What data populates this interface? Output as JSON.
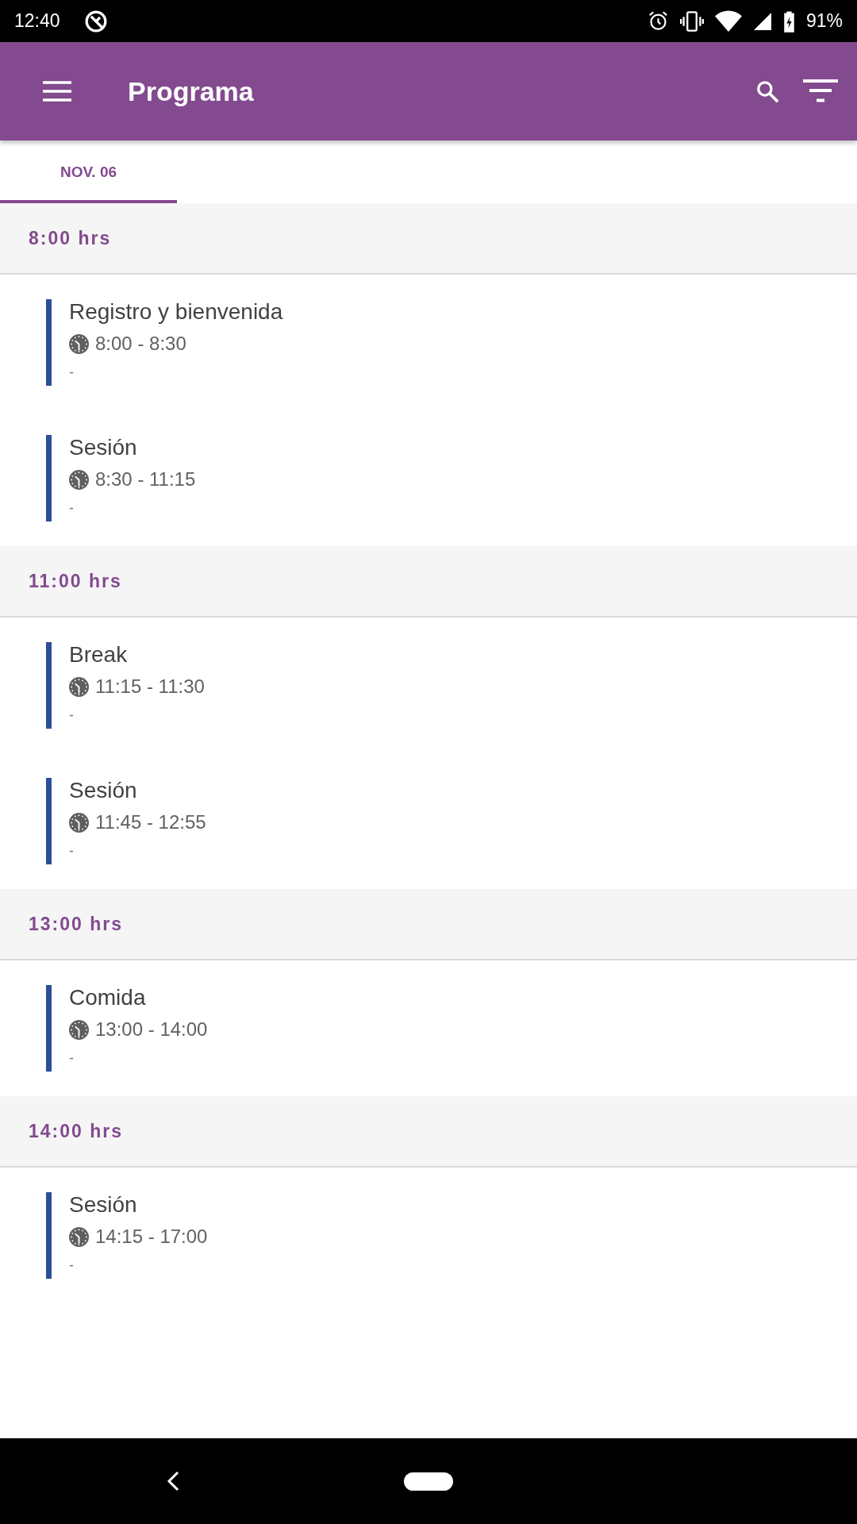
{
  "status_bar": {
    "time": "12:40",
    "battery": "91%"
  },
  "app_bar": {
    "title": "Programa"
  },
  "tabs": [
    {
      "label": "NOV. 06",
      "selected": true
    }
  ],
  "sections": [
    {
      "heading": "8:00 hrs",
      "events": [
        {
          "title": "Registro y bienvenida",
          "time": "8:00 - 8:30",
          "note": "-"
        },
        {
          "title": "Sesión",
          "time": "8:30 - 11:15",
          "note": "-"
        }
      ]
    },
    {
      "heading": "11:00 hrs",
      "events": [
        {
          "title": "Break",
          "time": "11:15 - 11:30",
          "note": "-"
        },
        {
          "title": "Sesión",
          "time": "11:45 - 12:55",
          "note": "-"
        }
      ]
    },
    {
      "heading": "13:00 hrs",
      "events": [
        {
          "title": "Comida",
          "time": "13:00 - 14:00",
          "note": "-"
        }
      ]
    },
    {
      "heading": "14:00 hrs",
      "events": [
        {
          "title": "Sesión",
          "time": "14:15 - 17:00",
          "note": "-"
        }
      ]
    }
  ]
}
